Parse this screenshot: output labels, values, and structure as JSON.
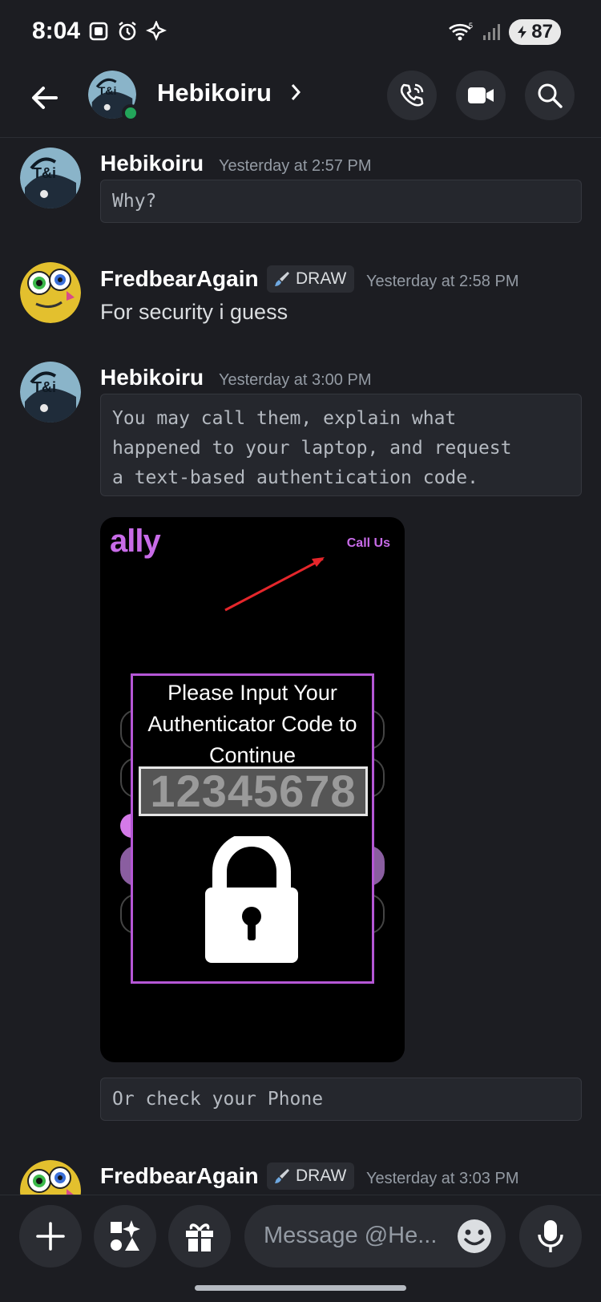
{
  "status_bar": {
    "time": "8:04",
    "battery": "87",
    "icons": [
      "screenshot-icon",
      "alarm-icon",
      "assistant-icon",
      "wifi-icon",
      "signal-icon",
      "battery-icon"
    ]
  },
  "header": {
    "title": "Hebikoiru",
    "status": "online",
    "icons": [
      "back-arrow-icon",
      "chevron-right-icon",
      "phone-call-icon",
      "video-camera-icon",
      "search-icon"
    ]
  },
  "messages": [
    {
      "author": "Hebikoiru",
      "time": "Yesterday at 2:57 PM",
      "code": "Why?"
    },
    {
      "author": "FredbearAgain",
      "badge": "DRAW",
      "time": "Yesterday at 2:58 PM",
      "text": "For security i guess"
    },
    {
      "author": "Hebikoiru",
      "time": "Yesterday at 3:00 PM",
      "code": "You may call them, explain what\nhappened to your laptop, and request\na text-based authentication code.",
      "attachment": {
        "logo": "ally",
        "link": "Call Us",
        "prompt": "Please Input Your Authenticator Code to Continue",
        "code": "12345678"
      },
      "code2": "Or check your Phone"
    },
    {
      "author": "FredbearAgain",
      "badge": "DRAW",
      "time": "Yesterday at 3:03 PM"
    }
  ],
  "composer": {
    "placeholder": "Message @He...",
    "icons": [
      "plus-icon",
      "apps-icon",
      "gift-icon",
      "emoji-icon",
      "microphone-icon"
    ]
  },
  "colors": {
    "background": "#1c1d22",
    "online": "#23a55a",
    "ally_purple": "#c86be8"
  }
}
